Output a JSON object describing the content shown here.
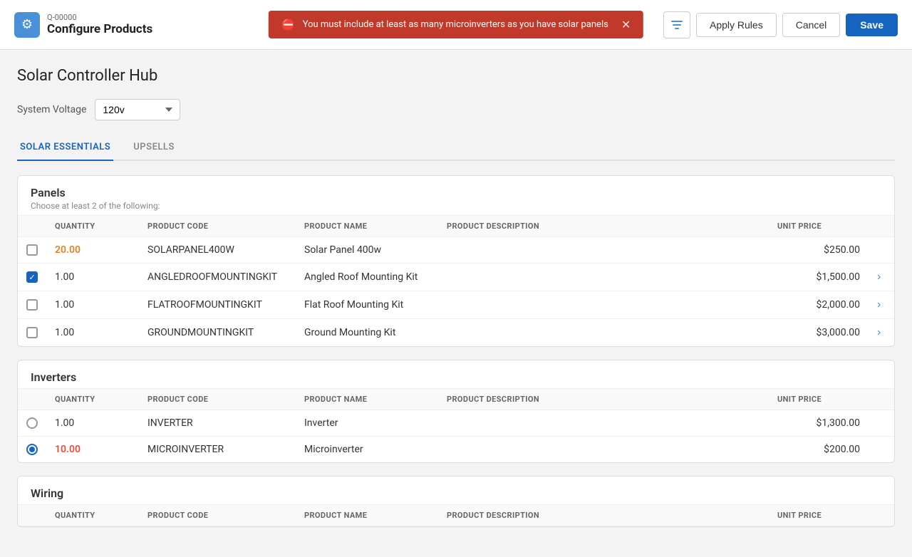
{
  "header": {
    "quote_number": "Q-00000",
    "title": "Configure Products",
    "alert_message": "You must include at least as many microinverters as you have solar panels",
    "apply_rules_label": "Apply Rules",
    "cancel_label": "Cancel",
    "save_label": "Save"
  },
  "page": {
    "title": "Solar Controller Hub",
    "system_voltage_label": "System Voltage",
    "system_voltage_value": "120v"
  },
  "tabs": [
    {
      "id": "solar-essentials",
      "label": "SOLAR ESSENTIALS",
      "active": true
    },
    {
      "id": "upsells",
      "label": "UPSELLS",
      "active": false
    }
  ],
  "sections": [
    {
      "id": "panels",
      "title": "Panels",
      "subtitle": "Choose at least 2 of the following:",
      "columns": [
        "QUANTITY",
        "PRODUCT CODE",
        "PRODUCT NAME",
        "PRODUCT DESCRIPTION",
        "UNIT PRICE"
      ],
      "rows": [
        {
          "selector": "checkbox",
          "checked": false,
          "qty": "20.00",
          "qty_style": "orange",
          "code": "SOLARPANEL400W",
          "name": "Solar Panel 400w",
          "description": "",
          "price": "$250.00",
          "has_action": false
        },
        {
          "selector": "checkbox",
          "checked": true,
          "qty": "1.00",
          "qty_style": "normal",
          "code": "ANGLEDROOFMOUNTINGKIT",
          "name": "Angled Roof Mounting Kit",
          "description": "",
          "price": "$1,500.00",
          "has_action": true
        },
        {
          "selector": "checkbox",
          "checked": false,
          "qty": "1.00",
          "qty_style": "normal",
          "code": "FLATROOFMOUNTINGKIT",
          "name": "Flat Roof Mounting Kit",
          "description": "",
          "price": "$2,000.00",
          "has_action": true
        },
        {
          "selector": "checkbox",
          "checked": false,
          "qty": "1.00",
          "qty_style": "normal",
          "code": "GROUNDMOUNTINGKIT",
          "name": "Ground Mounting Kit",
          "description": "",
          "price": "$3,000.00",
          "has_action": true
        }
      ]
    },
    {
      "id": "inverters",
      "title": "Inverters",
      "subtitle": "",
      "columns": [
        "QUANTITY",
        "PRODUCT CODE",
        "PRODUCT NAME",
        "PRODUCT DESCRIPTION",
        "UNIT PRICE"
      ],
      "rows": [
        {
          "selector": "radio",
          "checked": false,
          "qty": "1.00",
          "qty_style": "normal",
          "code": "INVERTER",
          "name": "Inverter",
          "description": "",
          "price": "$1,300.00",
          "has_action": false
        },
        {
          "selector": "radio",
          "checked": true,
          "qty": "10.00",
          "qty_style": "red",
          "code": "MICROINVERTER",
          "name": "Microinverter",
          "description": "",
          "price": "$200.00",
          "has_action": false
        }
      ]
    },
    {
      "id": "wiring",
      "title": "Wiring",
      "subtitle": "",
      "columns": [
        "QUANTITY",
        "PRODUCT CODE",
        "PRODUCT NAME",
        "PRODUCT DESCRIPTION",
        "UNIT PRICE"
      ],
      "rows": []
    }
  ]
}
